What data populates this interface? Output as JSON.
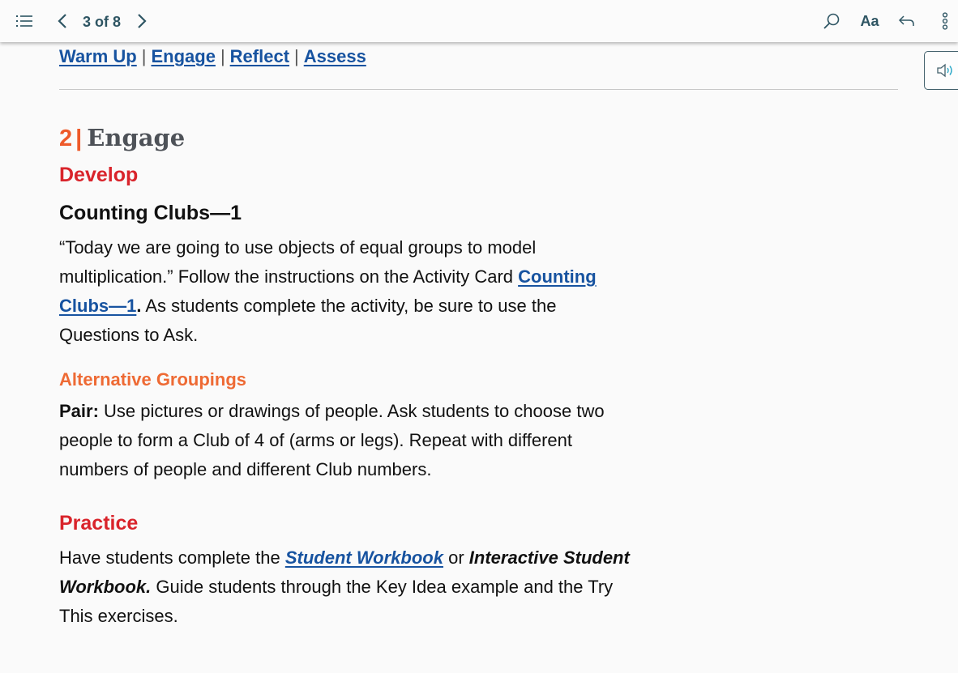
{
  "toolbar": {
    "toc_icon": "list-icon",
    "prev_icon": "chevron-left-icon",
    "page_indicator": "3 of 8",
    "next_icon": "chevron-right-icon",
    "search_icon": "search-icon",
    "font_size_label": "Aa",
    "back_icon": "undo-arrow-icon",
    "more_icon": "more-vertical-icon"
  },
  "audio_button": {
    "icon": "speaker-icon"
  },
  "nav_links": [
    {
      "label": "Warm Up"
    },
    {
      "label": "Engage"
    },
    {
      "label": "Reflect"
    },
    {
      "label": "Assess"
    }
  ],
  "nav_separator": "|",
  "colors": {
    "link": "#1753a0",
    "accent_orange": "#ee5a2a",
    "heading_red": "#d9242b",
    "toolbar_teal": "#2e5563"
  },
  "section": {
    "number": "2",
    "separator": "|",
    "title": "Engage"
  },
  "develop": {
    "heading": "Develop",
    "subheading": "Counting Clubs—1",
    "para_before_link": "“Today we are going to use objects of equal groups to model multiplication.” Follow the instructions on the Activity Card ",
    "link": "Counting Clubs—1",
    "link_period": ".",
    "para_after_link": " As students complete the activity, be sure to use the Questions to Ask."
  },
  "alternative_groupings": {
    "heading": "Alternative Groupings",
    "label": "Pair:",
    "text": " Use pictures or drawings of people. Ask students to choose two people to form a Club of 4 of (arms or legs). Repeat with different numbers of people and different Club numbers."
  },
  "practice": {
    "heading": "Practice",
    "text_before_link": "Have students complete the ",
    "link": "Student Workbook",
    "text_middle": " or ",
    "bold_italic": "Interactive Student Workbook.",
    "text_after": " Guide students through the Key Idea example and the Try This exercises."
  }
}
